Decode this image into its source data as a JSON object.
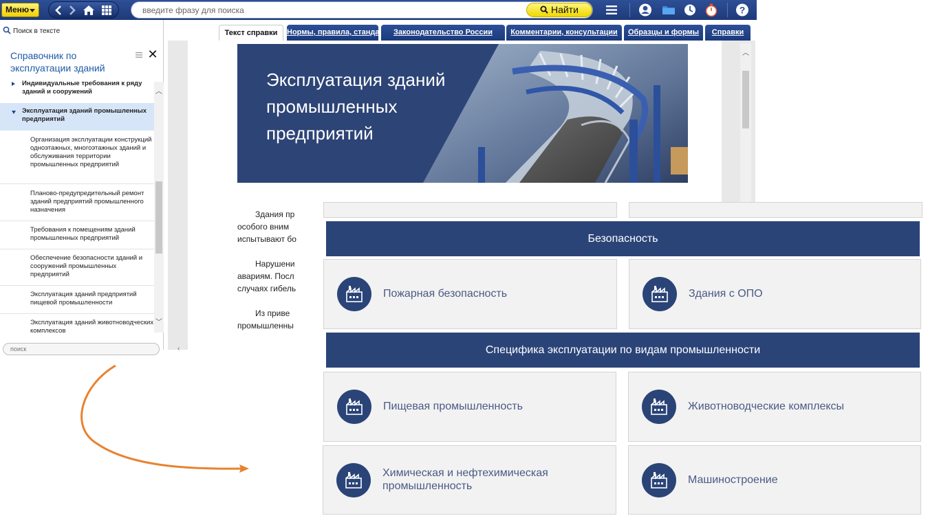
{
  "toolbar": {
    "menu_label": "Меню",
    "search_placeholder": "введите фразу для поиска",
    "find_label": "Найти"
  },
  "left_panel": {
    "search_in_text": "Поиск в тексте",
    "title": "Справочник по эксплуатации зданий",
    "search_placeholder": "поиск",
    "tree": [
      {
        "label": "Индивидуальные требования к ряду зданий и сооружений",
        "level": 1,
        "expanded": false,
        "selected": false
      },
      {
        "label": "Эксплуатация зданий промышленных предприятий",
        "level": 1,
        "expanded": true,
        "selected": true
      },
      {
        "label": "Организация эксплуатации конструкций одноэтажных, многоэтажных зданий и обслуживания территории промышленных предприятий",
        "level": 2
      },
      {
        "label": "Планово-предупредительный ремонт зданий предприятий промышленного назначения",
        "level": 2
      },
      {
        "label": "Требования к помещениям зданий промышленных предприятий",
        "level": 2
      },
      {
        "label": "Обеспечение безопасности зданий и сооружений промышленных предприятий",
        "level": 2
      },
      {
        "label": "Эксплуатация зданий предприятий пищевой промышленности",
        "level": 2
      },
      {
        "label": "Эксплуатация зданий животноводческих комплексов",
        "level": 2
      }
    ]
  },
  "tabs": [
    {
      "label": "Текст справки",
      "active": true
    },
    {
      "label": "Нормы, правила, стандарты",
      "active": false
    },
    {
      "label": "Законодательство России",
      "active": false
    },
    {
      "label": "Комментарии, консультации",
      "active": false
    },
    {
      "label": "Образцы и формы",
      "active": false
    },
    {
      "label": "Справки",
      "active": false
    }
  ],
  "document": {
    "banner_title": "Эксплуатация зданий промышленных предприятий",
    "paragraphs": [
      {
        "lines": [
          "Здания пр",
          "особого вним",
          "испытывают бо"
        ]
      },
      {
        "lines": [
          "Нарушени",
          "авариям. Посл",
          "случаях гибель"
        ]
      },
      {
        "lines": [
          "Из приве",
          "промышленны"
        ]
      }
    ]
  },
  "overlay": {
    "section_safety": "Безопасность",
    "section_industry": "Специфика эксплуатации по видам промышленности",
    "cards": [
      {
        "label": "Пожарная безопасность"
      },
      {
        "label": "Здания с ОПО"
      },
      {
        "label": "Пищевая промышленность"
      },
      {
        "label": "Животноводческие комплексы"
      },
      {
        "label": "Химическая и нефтехимическая промышленность"
      },
      {
        "label": "Машиностроение"
      }
    ]
  },
  "colors": {
    "toolbar": "#1e3a7a",
    "find_button": "#f5e100",
    "banner": "#2d4476",
    "section_bar": "#2b4478",
    "card_bg": "#f2f2f2",
    "card_text": "#4a5a85",
    "arrow": "#e8822e",
    "tree_selected": "#d6e6f8"
  }
}
